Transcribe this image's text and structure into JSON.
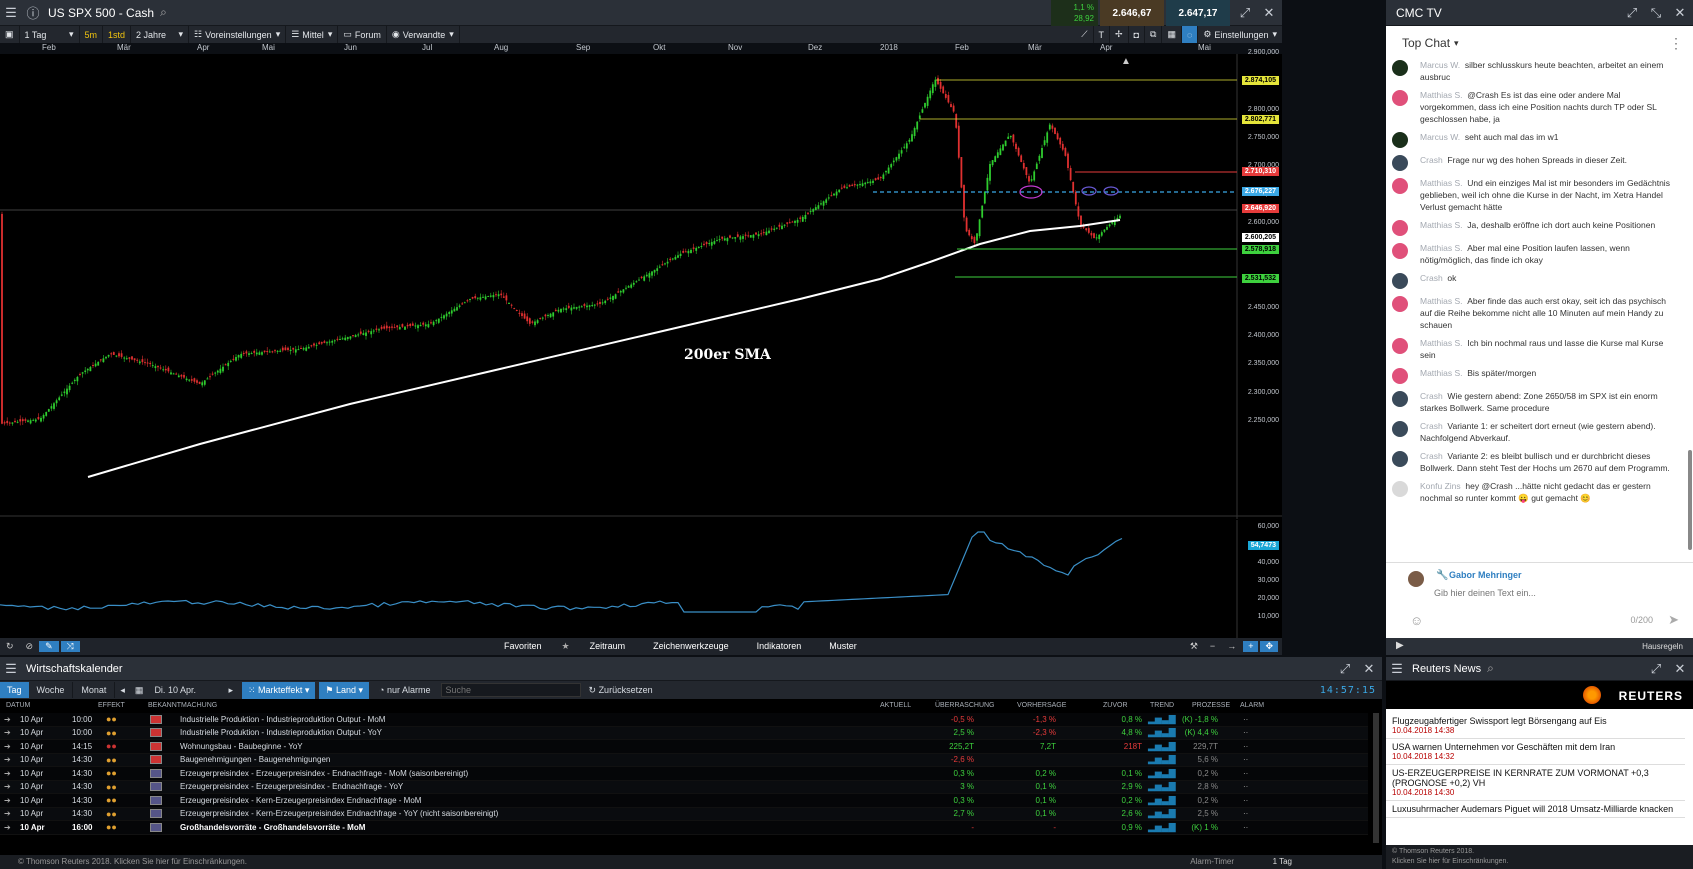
{
  "chart_window": {
    "title": "US SPX 500 - Cash",
    "change_pct": "1,1 %",
    "change_abs": "28,92",
    "bid": "2.646,67",
    "ask": "2.647,17",
    "toolbar": {
      "interval": "1 Tag",
      "btn_5m": "5m",
      "btn_1std": "1std",
      "range": "2 Jahre",
      "presets": "Voreinstellungen",
      "avg": "Mittel",
      "forum": "Forum",
      "related": "Verwandte",
      "settings": "Einstellungen"
    },
    "months": [
      "Feb",
      "Mär",
      "Apr",
      "Mai",
      "Jun",
      "Jul",
      "Aug",
      "Sep",
      "Okt",
      "Nov",
      "Dez",
      "2018",
      "Feb",
      "Mär",
      "Apr",
      "Mai"
    ],
    "price_axis": [
      "2.900,000",
      "2.850,000",
      "2.800,000",
      "2.750,000",
      "2.700,000",
      "2.650,000",
      "2.600,000",
      "2.550,000",
      "2.500,000",
      "2.450,000",
      "2.400,000",
      "2.350,000",
      "2.300,000",
      "2.250,000"
    ],
    "price_tags": {
      "t1": "2.874,105",
      "t2": "2.802,771",
      "t3": "2.710,310",
      "t4": "2.676,227",
      "t5": "2.646,920",
      "t6": "2.600,205",
      "t7": "2.578,918",
      "t8": "2.531,532"
    },
    "sma_label": "200er SMA",
    "indicator_axis": [
      "60,000",
      "50,000",
      "40,000",
      "30,000",
      "20,000",
      "10,000"
    ],
    "indicator_value": "54,7473",
    "bottom_tabs": [
      "Favoriten",
      "Zeitraum",
      "Zeichenwerkzeuge",
      "Indikatoren",
      "Muster"
    ]
  },
  "chat": {
    "window_title": "CMC TV",
    "room": "Top Chat",
    "messages": [
      {
        "name": "Marcus W.",
        "text": "silber schlusskurs heute beachten, arbeitet an einem ausbruc"
      },
      {
        "name": "Matthias S.",
        "text": "@Crash Es ist das eine oder andere Mal vorgekommen, dass ich eine Position nachts durch TP oder SL geschlossen habe, ja"
      },
      {
        "name": "Marcus W.",
        "text": "seht auch mal das im w1"
      },
      {
        "name": "Crash",
        "text": "Frage nur wg des hohen Spreads in dieser Zeit."
      },
      {
        "name": "Matthias S.",
        "text": "Und ein einziges Mal ist mir besonders im Gedächtnis geblieben, weil ich ohne die Kurse in der Nacht, im Xetra Handel Verlust gemacht hätte"
      },
      {
        "name": "Matthias S.",
        "text": "Ja, deshalb eröffne ich dort auch keine Positionen"
      },
      {
        "name": "Matthias S.",
        "text": "Aber mal eine Position laufen lassen, wenn nötig/möglich, das finde ich okay"
      },
      {
        "name": "Crash",
        "text": "ok"
      },
      {
        "name": "Matthias S.",
        "text": "Aber finde das auch erst okay, seit ich das psychisch auf die Reihe bekomme nicht alle 10 Minuten auf mein Handy zu schauen"
      },
      {
        "name": "Matthias S.",
        "text": "Ich bin nochmal raus und lasse die Kurse mal Kurse sein"
      },
      {
        "name": "Matthias S.",
        "text": "Bis später/morgen"
      },
      {
        "name": "Crash",
        "text": "Wie gestern abend: Zone 2650/58 im SPX ist ein enorm starkes Bollwerk. Same procedure"
      },
      {
        "name": "Crash",
        "text": "Variante 1: er scheitert dort erneut (wie gestern abend). Nachfolgend Abverkauf."
      },
      {
        "name": "Crash",
        "text": "Variante 2: es bleibt bullisch und er durchbricht dieses Bollwerk. Dann steht Test der Hochs um 2670 auf dem Programm."
      },
      {
        "name": "Konfu Zins",
        "text": "hey @Crash ...hätte nicht gedacht das er gestern nochmal so runter kommt 😛 gut gemacht 😊"
      }
    ],
    "user": "Gabor Mehringer",
    "input_placeholder": "Gib hier deinen Text ein...",
    "char_count": "0/200",
    "footer_right": "Hausregeln"
  },
  "calendar": {
    "title": "Wirtschaftskalender",
    "tabs": [
      "Tag",
      "Woche",
      "Monat"
    ],
    "date": "Di. 10 Apr.",
    "market_effect": "Markteffekt",
    "country": "Land",
    "alarms_only": "nur Alarme",
    "search_placeholder": "Suche",
    "reset": "Zurücksetzen",
    "clock": "14:57:15",
    "columns": [
      "DATUM",
      "EFFEKT",
      "BEKANNTMACHUNG",
      "AKTUELL",
      "ÜBERRASCHUNG",
      "VORHERSAGE",
      "ZUVOR",
      "TREND",
      "PROZESSE",
      "ALARM"
    ],
    "rows": [
      {
        "date": "10 Apr",
        "time": "10:00",
        "name": "Industrielle Produktion - Industrieproduktion Output - MoM",
        "actual": "-0,5 %",
        "surprise": "-1,3 %",
        "forecast": "0,8 %",
        "prev": "(K) -1,8 %"
      },
      {
        "date": "10 Apr",
        "time": "10:00",
        "name": "Industrielle Produktion - Industrieproduktion Output - YoY",
        "actual": "2,5 %",
        "surprise": "-2,3 %",
        "forecast": "4,8 %",
        "prev": "(K) 4,4 %"
      },
      {
        "date": "10 Apr",
        "time": "14:15",
        "name": "Wohnungsbau - Baubeginne - YoY",
        "actual": "225,2T",
        "surprise": "7,2T",
        "forecast": "218T",
        "prev": "229,7T"
      },
      {
        "date": "10 Apr",
        "time": "14:30",
        "name": "Baugenehmigungen - Baugenehmigungen",
        "actual": "-2,6 %",
        "surprise": "",
        "forecast": "",
        "prev": "5,6 %"
      },
      {
        "date": "10 Apr",
        "time": "14:30",
        "name": "Erzeugerpreisindex - Erzeugerpreisindex - Endnachfrage - MoM (saisonbereinigt)",
        "actual": "0,3 %",
        "surprise": "0,2 %",
        "forecast": "0,1 %",
        "prev": "0,2 %"
      },
      {
        "date": "10 Apr",
        "time": "14:30",
        "name": "Erzeugerpreisindex - Erzeugerpreisindex - Endnachfrage - YoY",
        "actual": "3 %",
        "surprise": "0,1 %",
        "forecast": "2,9 %",
        "prev": "2,8 %"
      },
      {
        "date": "10 Apr",
        "time": "14:30",
        "name": "Erzeugerpreisindex - Kern-Erzeugerpreisindex Endnachfrage - MoM",
        "actual": "0,3 %",
        "surprise": "0,1 %",
        "forecast": "0,2 %",
        "prev": "0,2 %"
      },
      {
        "date": "10 Apr",
        "time": "14:30",
        "name": "Erzeugerpreisindex - Kern-Erzeugerpreisindex Endnachfrage - YoY (nicht saisonbereinigt)",
        "actual": "2,7 %",
        "surprise": "0,1 %",
        "forecast": "2,6 %",
        "prev": "2,5 %"
      },
      {
        "date": "10 Apr",
        "time": "16:00",
        "name": "Großhandelsvorräte - Großhandelsvorräte - MoM",
        "actual": "-",
        "surprise": "-",
        "forecast": "0,9 %",
        "prev": "(K) 1 %"
      }
    ],
    "footer": "© Thomson Reuters 2018. Klicken Sie hier für Einschränkungen.",
    "alarm_timer": "Alarm-Timer",
    "interval": "1 Tag"
  },
  "news": {
    "title": "Reuters News",
    "brand": "REUTERS",
    "items": [
      {
        "headline": "Flugzeugabfertiger Swissport legt Börsengang auf Eis",
        "time": "10.04.2018 14:38"
      },
      {
        "headline": "USA warnen Unternehmen vor Geschäften mit dem Iran",
        "time": "10.04.2018 14:32"
      },
      {
        "headline": "US-ERZEUGERPREISE IN KERNRATE ZUM VORMONAT +0,3 (PROGNOSE +0,2) VH",
        "time": "10.04.2018 14:30"
      },
      {
        "headline": "Luxusuhrmacher Audemars Piguet will 2018 Umsatz-Milliarde knacken",
        "time": ""
      }
    ],
    "footer1": "© Thomson Reuters 2018.",
    "footer2": "Klicken Sie hier für Einschränkungen."
  }
}
